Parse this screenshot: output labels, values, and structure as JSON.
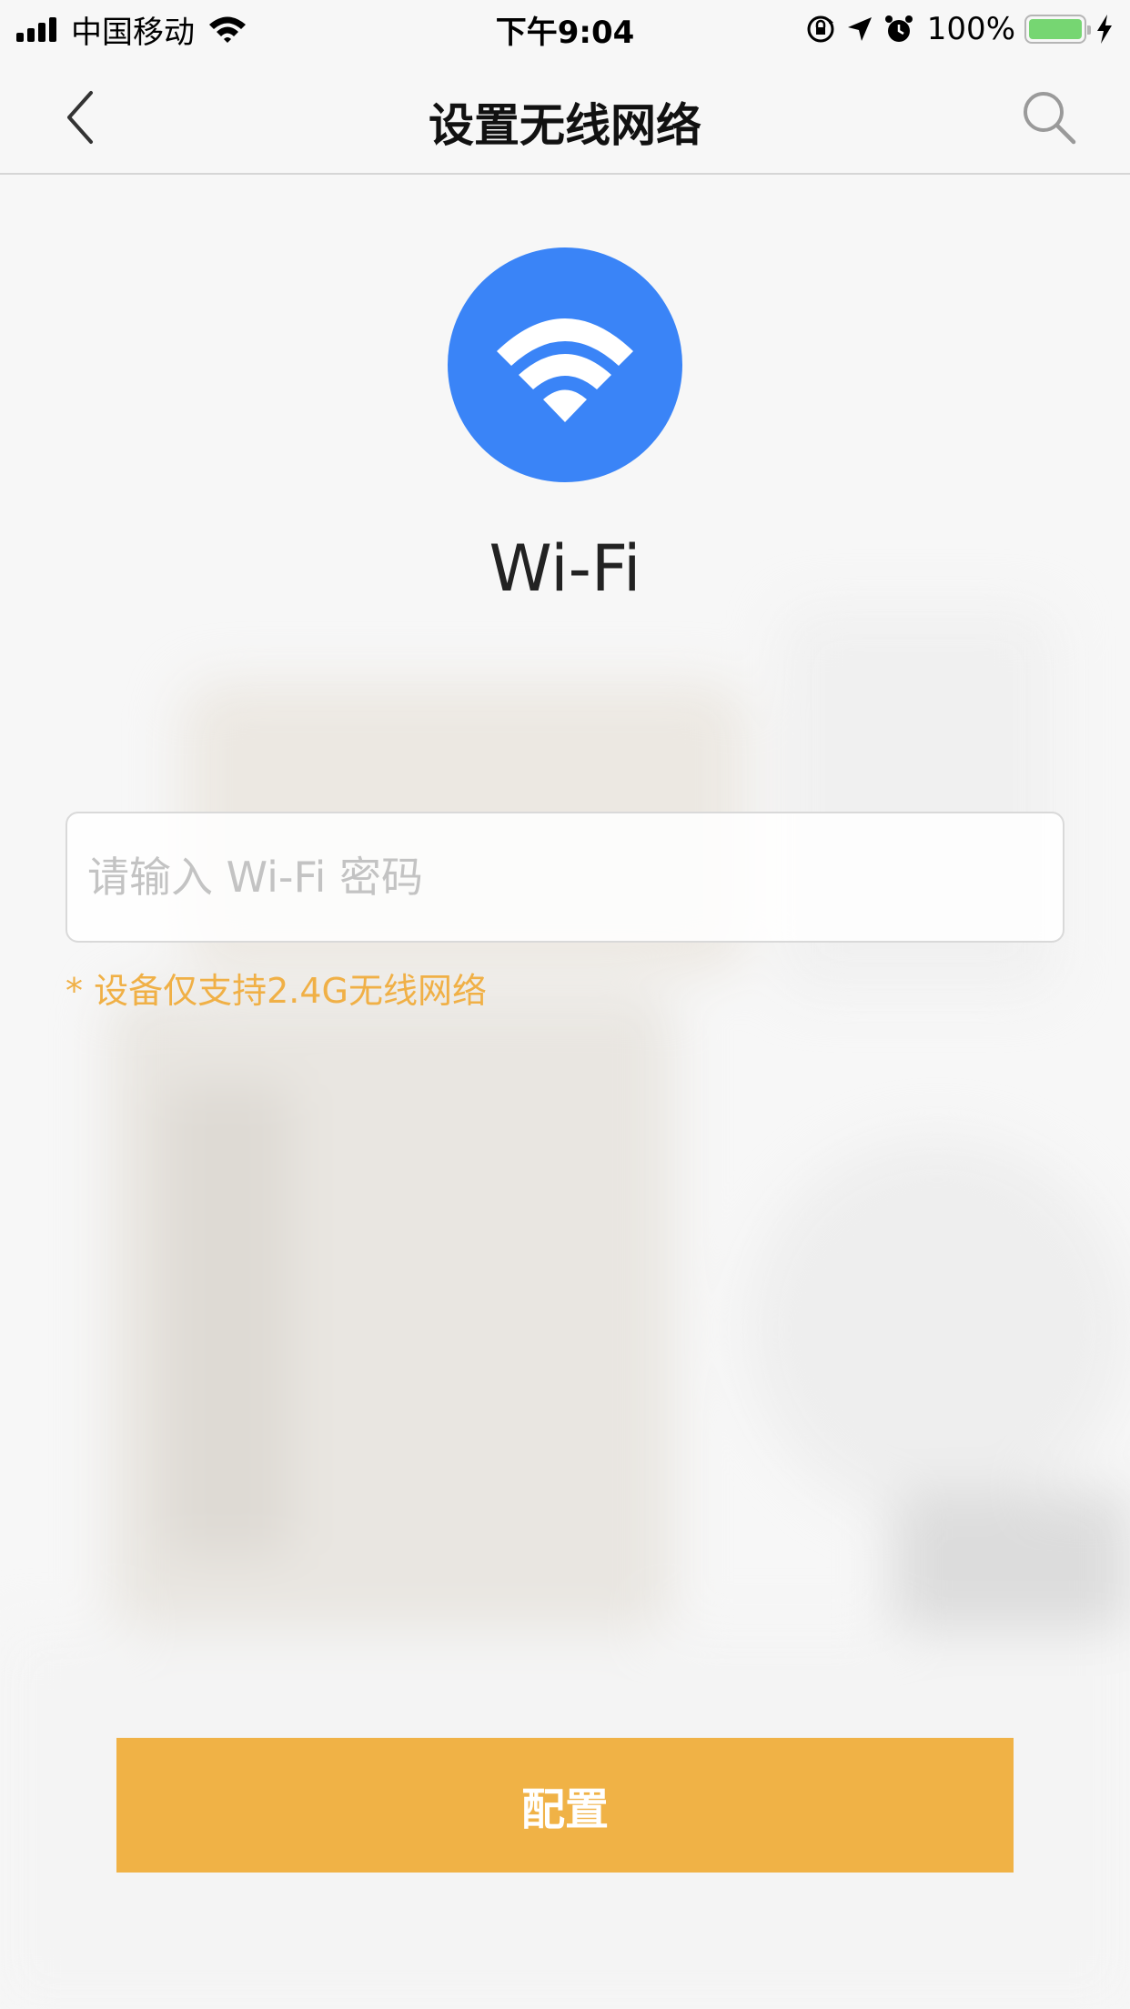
{
  "status_bar": {
    "carrier": "中国移动",
    "time": "下午9:04",
    "battery_percent": "100%",
    "battery_level": 1.0,
    "battery_color": "#76d672",
    "icons": [
      "signal-icon",
      "wifi-icon",
      "rotation-lock-icon",
      "location-icon",
      "alarm-icon",
      "battery-icon",
      "charging-icon"
    ]
  },
  "nav": {
    "title": "设置无线网络",
    "back_icon": "chevron-left-icon",
    "search_icon": "search-icon"
  },
  "main": {
    "wifi_icon": "wifi-icon",
    "wifi_color": "#3a84f7",
    "wifi_label": "Wi-Fi",
    "password_placeholder": "请输入 Wi-Fi 密码",
    "password_value": "",
    "hint": "* 设备仅支持2.4G无线网络",
    "hint_color": "#f0b046",
    "config_button": "配置",
    "config_button_color": "#f0b246"
  }
}
